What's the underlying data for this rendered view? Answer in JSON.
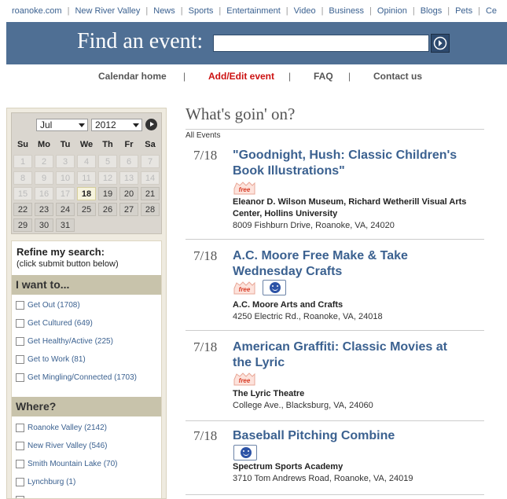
{
  "topnav": [
    "roanoke.com",
    "New River Valley",
    "News",
    "Sports",
    "Entertainment",
    "Video",
    "Business",
    "Opinion",
    "Blogs",
    "Pets",
    "Ce"
  ],
  "find": {
    "label": "Find an event:",
    "query": ""
  },
  "subnav": {
    "calendar_home": "Calendar home",
    "add_edit": "Add/Edit event",
    "faq": "FAQ",
    "contact": "Contact us",
    "separator": "|"
  },
  "calendar": {
    "month": "Jul",
    "year": "2012",
    "weekdays": [
      "Su",
      "Mo",
      "Tu",
      "We",
      "Th",
      "Fr",
      "Sa"
    ],
    "days": [
      "1",
      "2",
      "3",
      "4",
      "5",
      "6",
      "7",
      "8",
      "9",
      "10",
      "11",
      "12",
      "13",
      "14",
      "15",
      "16",
      "17",
      "18",
      "19",
      "20",
      "21",
      "22",
      "23",
      "24",
      "25",
      "26",
      "27",
      "28",
      "29",
      "30",
      "31"
    ],
    "today": "18"
  },
  "refine": {
    "title": "Refine my search:",
    "subtitle": "(click submit button below)",
    "sections": [
      {
        "heading": "I want to...",
        "options": [
          "Get Out (1708)",
          "Get Cultured (649)",
          "Get Healthy/Active (225)",
          "Get to Work (81)",
          "Get Mingling/Connected (1703)"
        ]
      },
      {
        "heading": "Where?",
        "options": [
          "Roanoke Valley (2142)",
          "New River Valley (546)",
          "Smith Mountain Lake (70)",
          "Lynchburg (1)"
        ]
      }
    ]
  },
  "main": {
    "title": "What's goin' on?",
    "all_events": "All Events"
  },
  "events": [
    {
      "date": "7/18",
      "title": "\"Goodnight, Hush: Classic Children's Book Illustrations\"",
      "venue": "Eleanor D. Wilson Museum, Richard Wetherill Visual Arts Center, Hollins University",
      "address": "8009 Fishburn Drive, Roanoke, VA, 24020",
      "free": true,
      "kids": false
    },
    {
      "date": "7/18",
      "title": "A.C. Moore Free Make & Take Wednesday Crafts",
      "venue": "A.C. Moore Arts and Crafts",
      "address": "4250 Electric Rd., Roanoke, VA, 24018",
      "free": true,
      "kids": true
    },
    {
      "date": "7/18",
      "title": "American Graffiti: Classic Movies at the Lyric",
      "venue": "The Lyric Theatre",
      "address": "College Ave., Blacksburg, VA, 24060",
      "free": true,
      "kids": false
    },
    {
      "date": "7/18",
      "title": "Baseball Pitching Combine",
      "venue": "Spectrum Sports Academy",
      "address": "3710 Tom Andrews Road, Roanoke, VA, 24019",
      "free": false,
      "kids": true
    }
  ],
  "icons": {
    "free": "free-badge-icon",
    "kids": "kid-friendly-icon",
    "go": "go-arrow-icon",
    "next": "next-month-icon"
  }
}
